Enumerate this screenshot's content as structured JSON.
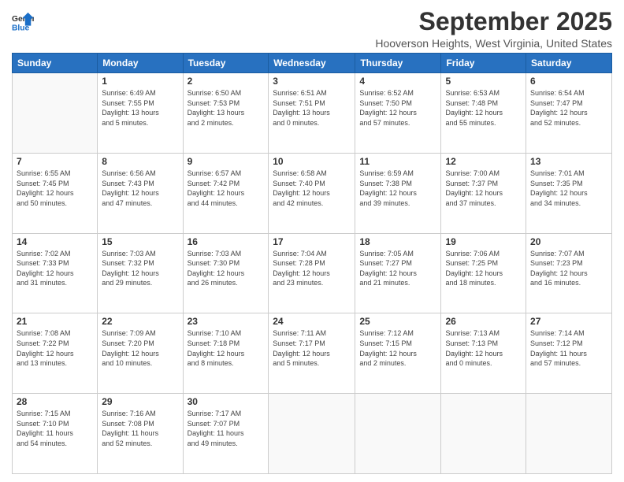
{
  "logo": {
    "line1": "General",
    "line2": "Blue"
  },
  "title": "September 2025",
  "location": "Hooverson Heights, West Virginia, United States",
  "days_of_week": [
    "Sunday",
    "Monday",
    "Tuesday",
    "Wednesday",
    "Thursday",
    "Friday",
    "Saturday"
  ],
  "weeks": [
    [
      {
        "day": "",
        "info": ""
      },
      {
        "day": "1",
        "info": "Sunrise: 6:49 AM\nSunset: 7:55 PM\nDaylight: 13 hours\nand 5 minutes."
      },
      {
        "day": "2",
        "info": "Sunrise: 6:50 AM\nSunset: 7:53 PM\nDaylight: 13 hours\nand 2 minutes."
      },
      {
        "day": "3",
        "info": "Sunrise: 6:51 AM\nSunset: 7:51 PM\nDaylight: 13 hours\nand 0 minutes."
      },
      {
        "day": "4",
        "info": "Sunrise: 6:52 AM\nSunset: 7:50 PM\nDaylight: 12 hours\nand 57 minutes."
      },
      {
        "day": "5",
        "info": "Sunrise: 6:53 AM\nSunset: 7:48 PM\nDaylight: 12 hours\nand 55 minutes."
      },
      {
        "day": "6",
        "info": "Sunrise: 6:54 AM\nSunset: 7:47 PM\nDaylight: 12 hours\nand 52 minutes."
      }
    ],
    [
      {
        "day": "7",
        "info": "Sunrise: 6:55 AM\nSunset: 7:45 PM\nDaylight: 12 hours\nand 50 minutes."
      },
      {
        "day": "8",
        "info": "Sunrise: 6:56 AM\nSunset: 7:43 PM\nDaylight: 12 hours\nand 47 minutes."
      },
      {
        "day": "9",
        "info": "Sunrise: 6:57 AM\nSunset: 7:42 PM\nDaylight: 12 hours\nand 44 minutes."
      },
      {
        "day": "10",
        "info": "Sunrise: 6:58 AM\nSunset: 7:40 PM\nDaylight: 12 hours\nand 42 minutes."
      },
      {
        "day": "11",
        "info": "Sunrise: 6:59 AM\nSunset: 7:38 PM\nDaylight: 12 hours\nand 39 minutes."
      },
      {
        "day": "12",
        "info": "Sunrise: 7:00 AM\nSunset: 7:37 PM\nDaylight: 12 hours\nand 37 minutes."
      },
      {
        "day": "13",
        "info": "Sunrise: 7:01 AM\nSunset: 7:35 PM\nDaylight: 12 hours\nand 34 minutes."
      }
    ],
    [
      {
        "day": "14",
        "info": "Sunrise: 7:02 AM\nSunset: 7:33 PM\nDaylight: 12 hours\nand 31 minutes."
      },
      {
        "day": "15",
        "info": "Sunrise: 7:03 AM\nSunset: 7:32 PM\nDaylight: 12 hours\nand 29 minutes."
      },
      {
        "day": "16",
        "info": "Sunrise: 7:03 AM\nSunset: 7:30 PM\nDaylight: 12 hours\nand 26 minutes."
      },
      {
        "day": "17",
        "info": "Sunrise: 7:04 AM\nSunset: 7:28 PM\nDaylight: 12 hours\nand 23 minutes."
      },
      {
        "day": "18",
        "info": "Sunrise: 7:05 AM\nSunset: 7:27 PM\nDaylight: 12 hours\nand 21 minutes."
      },
      {
        "day": "19",
        "info": "Sunrise: 7:06 AM\nSunset: 7:25 PM\nDaylight: 12 hours\nand 18 minutes."
      },
      {
        "day": "20",
        "info": "Sunrise: 7:07 AM\nSunset: 7:23 PM\nDaylight: 12 hours\nand 16 minutes."
      }
    ],
    [
      {
        "day": "21",
        "info": "Sunrise: 7:08 AM\nSunset: 7:22 PM\nDaylight: 12 hours\nand 13 minutes."
      },
      {
        "day": "22",
        "info": "Sunrise: 7:09 AM\nSunset: 7:20 PM\nDaylight: 12 hours\nand 10 minutes."
      },
      {
        "day": "23",
        "info": "Sunrise: 7:10 AM\nSunset: 7:18 PM\nDaylight: 12 hours\nand 8 minutes."
      },
      {
        "day": "24",
        "info": "Sunrise: 7:11 AM\nSunset: 7:17 PM\nDaylight: 12 hours\nand 5 minutes."
      },
      {
        "day": "25",
        "info": "Sunrise: 7:12 AM\nSunset: 7:15 PM\nDaylight: 12 hours\nand 2 minutes."
      },
      {
        "day": "26",
        "info": "Sunrise: 7:13 AM\nSunset: 7:13 PM\nDaylight: 12 hours\nand 0 minutes."
      },
      {
        "day": "27",
        "info": "Sunrise: 7:14 AM\nSunset: 7:12 PM\nDaylight: 11 hours\nand 57 minutes."
      }
    ],
    [
      {
        "day": "28",
        "info": "Sunrise: 7:15 AM\nSunset: 7:10 PM\nDaylight: 11 hours\nand 54 minutes."
      },
      {
        "day": "29",
        "info": "Sunrise: 7:16 AM\nSunset: 7:08 PM\nDaylight: 11 hours\nand 52 minutes."
      },
      {
        "day": "30",
        "info": "Sunrise: 7:17 AM\nSunset: 7:07 PM\nDaylight: 11 hours\nand 49 minutes."
      },
      {
        "day": "",
        "info": ""
      },
      {
        "day": "",
        "info": ""
      },
      {
        "day": "",
        "info": ""
      },
      {
        "day": "",
        "info": ""
      }
    ]
  ]
}
